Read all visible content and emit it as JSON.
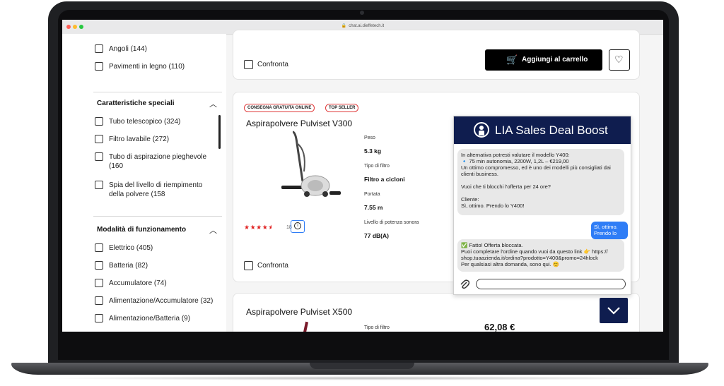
{
  "browser": {
    "url": "chat.ai.dieffetech.it"
  },
  "filters": {
    "top_items": [
      {
        "label": "Angoli (144)"
      },
      {
        "label": "Pavimenti in legno (110)"
      }
    ],
    "special": {
      "title": "Caratteristiche speciali",
      "items": [
        {
          "label": "Tubo telescopico (324)"
        },
        {
          "label": "Filtro lavabile (272)"
        },
        {
          "label": "Tubo di aspirazione pieghevole (160"
        },
        {
          "label": "Spia del livello di riempimento della polvere (158"
        }
      ]
    },
    "mode": {
      "title": "Modalità di funzionamento",
      "items": [
        {
          "label": "Elettrico (405)"
        },
        {
          "label": "Batteria (82)"
        },
        {
          "label": "Accumulatore (74)"
        },
        {
          "label": "Alimentazione/Accumulatore (32)"
        },
        {
          "label": "Alimentazione/Batteria (9)"
        }
      ]
    }
  },
  "top_card": {
    "compare_label": "Confronta",
    "cart_label": "Aggiungi al carrello"
  },
  "product1": {
    "badges": [
      "CONSEGNA GRATUITA ONLINE",
      "TOP SELLER"
    ],
    "title": "Aspirapolvere Pulviset V300",
    "specs": [
      {
        "label": "Peso",
        "value": "5.3 kg"
      },
      {
        "label": "Tipo di filtro",
        "value": "Filtro a cicloni"
      },
      {
        "label": "Portata",
        "value": "7.55 m"
      },
      {
        "label": "Livello di potenza sonora",
        "value": "77 dB(A)"
      }
    ],
    "rating_stars": 4.5,
    "review_count": "18",
    "compare_label": "Confronta"
  },
  "product2": {
    "title": "Aspirapolvere Pulviset X500",
    "spec_label": "Tipo di filtro",
    "price": "62,08 €"
  },
  "chat": {
    "title": "LIA Sales Deal Boost",
    "msg1_lines": [
      "In alternativa potresti valutare il modello Y400:",
      "🔹 75 min autonomia, 2200W, 1,2L – €219,00",
      "Un ottimo compromesso, ed è uno dei modelli più consigliati dai",
      "clienti business.",
      "",
      "Vuoi che ti blocchi l'offerta per 24 ore?",
      "",
      "Cliente:",
      "Sì, ottimo. Prendo lo Y400!"
    ],
    "user_msg_lines": [
      "Sì, ottimo.",
      "Prendo lo"
    ],
    "msg2_lines": [
      "✅ Fatto! Offerta bloccata.",
      "Puoi completare l'ordine quando vuoi da questo link 👉 https://",
      "shop.tuaazienda.it/ordina?prodotto=Y400&promo=24hlock",
      "Per qualsiasi altra domanda, sono qui. 😊"
    ]
  },
  "colors": {
    "chat_header": "#0f1d4f",
    "badge_border": "#e03b3b",
    "star": "#e02020",
    "user_bubble": "#2f7df6"
  }
}
